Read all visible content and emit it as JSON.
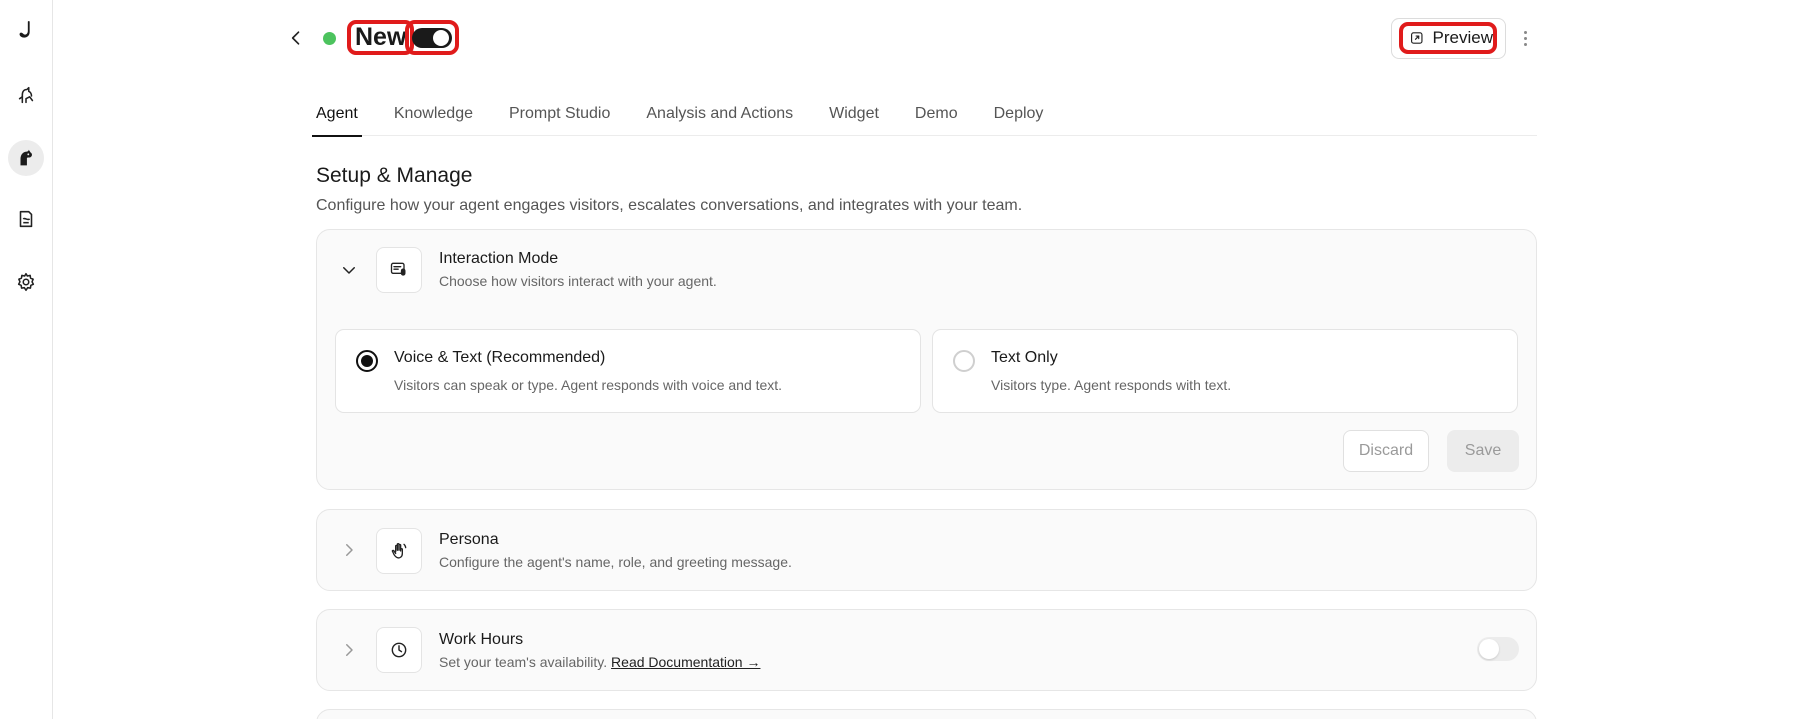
{
  "sidebar": {
    "items": [
      {
        "icon": "logo-icon"
      },
      {
        "icon": "agents-icon"
      },
      {
        "icon": "conversations-icon",
        "active": true
      },
      {
        "icon": "knowledge-icon"
      },
      {
        "icon": "settings-icon"
      }
    ]
  },
  "header": {
    "agent_name": "New",
    "status_color": "#4cc35e",
    "enabled": true,
    "preview_label": "Preview"
  },
  "tabs": [
    {
      "label": "Agent",
      "active": true
    },
    {
      "label": "Knowledge"
    },
    {
      "label": "Prompt Studio"
    },
    {
      "label": "Analysis and Actions"
    },
    {
      "label": "Widget"
    },
    {
      "label": "Demo"
    },
    {
      "label": "Deploy"
    }
  ],
  "section": {
    "title": "Setup & Manage",
    "subtitle": "Configure how your agent engages visitors, escalates conversations, and integrates with your team."
  },
  "interaction_mode": {
    "title": "Interaction Mode",
    "description": "Choose how visitors interact with your agent.",
    "options": [
      {
        "title": "Voice & Text (Recommended)",
        "description": "Visitors can speak or type. Agent responds with voice and text.",
        "selected": true
      },
      {
        "title": "Text Only",
        "description": "Visitors type. Agent responds with text.",
        "selected": false
      }
    ],
    "discard_label": "Discard",
    "save_label": "Save"
  },
  "persona": {
    "title": "Persona",
    "description": "Configure the agent's name, role, and greeting message."
  },
  "work_hours": {
    "title": "Work Hours",
    "description": "Set your team's availability.",
    "link_label": "Read Documentation →",
    "enabled": false
  }
}
